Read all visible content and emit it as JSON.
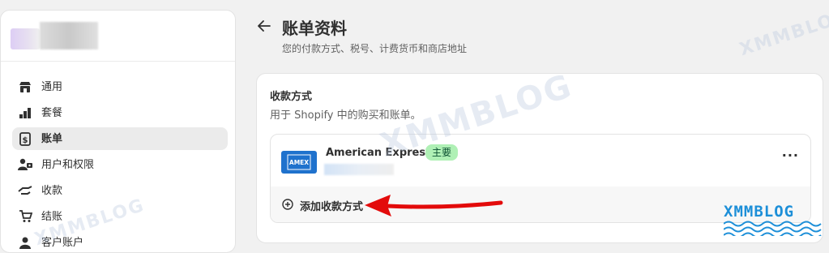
{
  "sidebar": {
    "items": [
      {
        "label": "通用",
        "icon": "store-icon",
        "active": false
      },
      {
        "label": "套餐",
        "icon": "plan-icon",
        "active": false
      },
      {
        "label": "账单",
        "icon": "billing-icon",
        "active": true
      },
      {
        "label": "用户和权限",
        "icon": "users-icon",
        "active": false
      },
      {
        "label": "收款",
        "icon": "payments-icon",
        "active": false
      },
      {
        "label": "结账",
        "icon": "cart-icon",
        "active": false
      },
      {
        "label": "客户账户",
        "icon": "customer-icon",
        "active": false
      }
    ]
  },
  "header": {
    "title": "账单资料",
    "subtitle": "您的付款方式、税号、计费货币和商店地址"
  },
  "payment_card": {
    "title": "收款方式",
    "description": "用于 Shopify 中的购买和账单。",
    "method": {
      "brand": "American Express",
      "logo_text": "AMEX",
      "badge": "主要"
    },
    "more_label": "···",
    "add_label": "添加收款方式"
  },
  "watermark": {
    "text": "XMMBLOG"
  },
  "colors": {
    "accent_badge_bg": "#aff0b5",
    "amex_blue": "#1f72cd",
    "annotation_red": "#e30b0b"
  }
}
